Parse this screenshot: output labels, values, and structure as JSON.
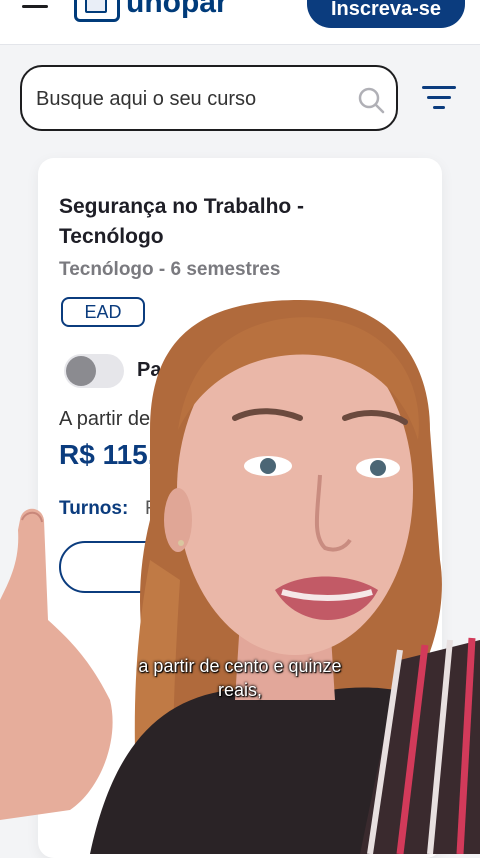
{
  "header": {
    "logo_text": "unopar",
    "cta_label": "Inscreva-se"
  },
  "search": {
    "placeholder": "Busque aqui o seu curso"
  },
  "course": {
    "title": "Segurança no Trabalho - Tecnólogo",
    "subtitle": "Tecnólogo - 6 semestres",
    "badge": "EAD",
    "toggle_label": "Pag",
    "price_prefix": "A partir de",
    "price": "R$ 115,",
    "turnos_label": "Turnos:",
    "turnos_value": "F"
  },
  "caption": {
    "line1": "a partir de cento e quinze",
    "line2": "reais,"
  },
  "colors": {
    "brand": "#0b3c7e",
    "background": "#f3f4f6"
  }
}
